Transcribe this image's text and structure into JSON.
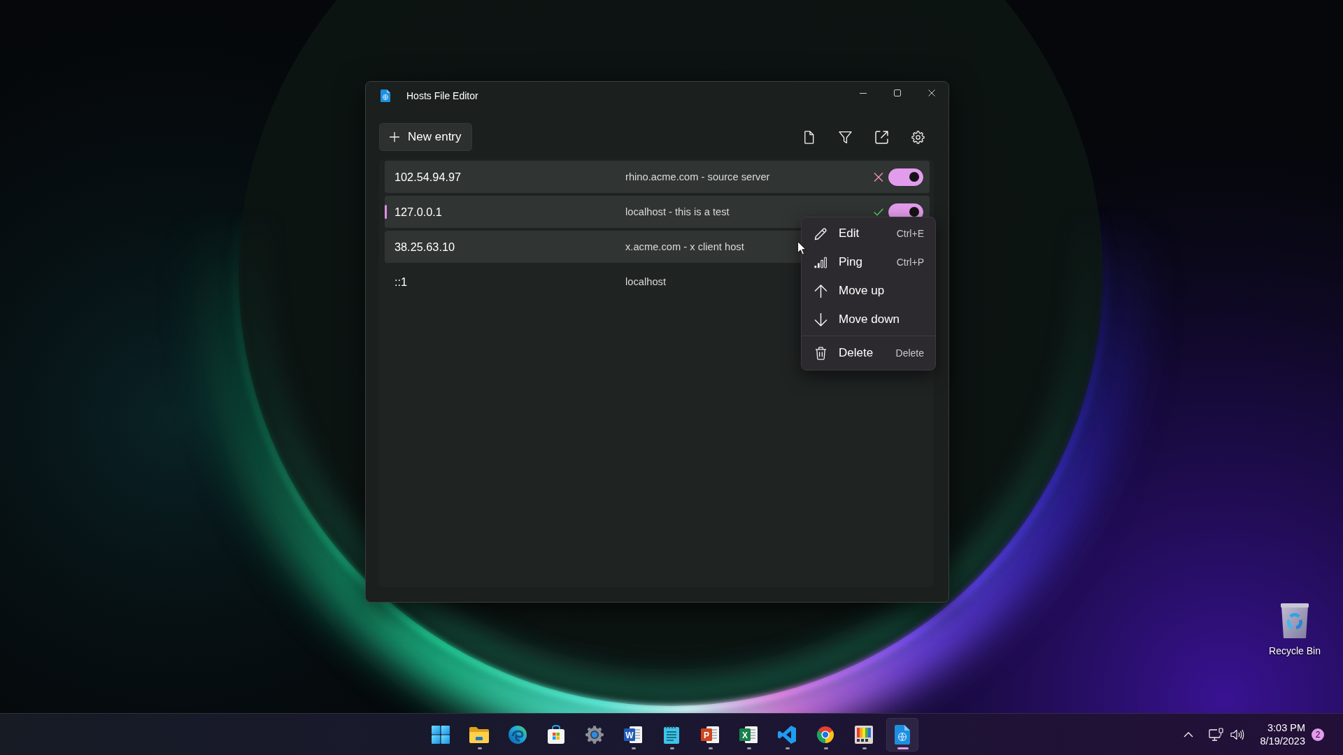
{
  "window": {
    "title": "Hosts File Editor"
  },
  "toolbar": {
    "new_entry": "New entry"
  },
  "entries": [
    {
      "address": "102.54.94.97",
      "names": "rhino.acme.com - source server",
      "highlighted": true,
      "selected": false,
      "reachable": false,
      "on": true
    },
    {
      "address": "127.0.0.1",
      "names": "localhost - this is a test",
      "highlighted": true,
      "selected": true,
      "reachable": true,
      "on": true
    },
    {
      "address": "38.25.63.10",
      "names": "x.acme.com - x client host",
      "highlighted": true,
      "selected": false
    },
    {
      "address": "::1",
      "names": "localhost",
      "highlighted": false,
      "selected": false
    }
  ],
  "context_menu": {
    "groups": [
      [
        {
          "kind": "edit",
          "label": "Edit",
          "shortcut": "Ctrl+E"
        },
        {
          "kind": "ping",
          "label": "Ping",
          "shortcut": "Ctrl+P"
        },
        {
          "kind": "move_up",
          "label": "Move up"
        },
        {
          "kind": "move_down",
          "label": "Move down"
        }
      ],
      [
        {
          "kind": "delete",
          "label": "Delete",
          "shortcut": "Delete"
        }
      ]
    ]
  },
  "desktop_icons": [
    {
      "kind": "recycle_bin",
      "label": "Recycle Bin"
    }
  ],
  "taskbar": {
    "apps": [
      {
        "kind": "start",
        "running": false,
        "active": false
      },
      {
        "kind": "file_explorer",
        "running": true,
        "active": false
      },
      {
        "kind": "edge",
        "running": false,
        "active": false
      },
      {
        "kind": "store",
        "running": false,
        "active": false
      },
      {
        "kind": "settings",
        "running": false,
        "active": false
      },
      {
        "kind": "word",
        "letter": "W",
        "running": true,
        "active": false
      },
      {
        "kind": "notepad",
        "running": true,
        "active": false
      },
      {
        "kind": "powerpoint",
        "letter": "P",
        "running": true,
        "active": false
      },
      {
        "kind": "excel",
        "letter": "X",
        "running": true,
        "active": false
      },
      {
        "kind": "vscode",
        "running": true,
        "active": false
      },
      {
        "kind": "chrome",
        "running": true,
        "active": false
      },
      {
        "kind": "color_picker",
        "running": true,
        "active": false
      },
      {
        "kind": "hosts_editor",
        "running": true,
        "active": true
      }
    ],
    "tray": {
      "time": "3:03 PM",
      "date": "8/19/2023",
      "notifications": "2"
    }
  }
}
